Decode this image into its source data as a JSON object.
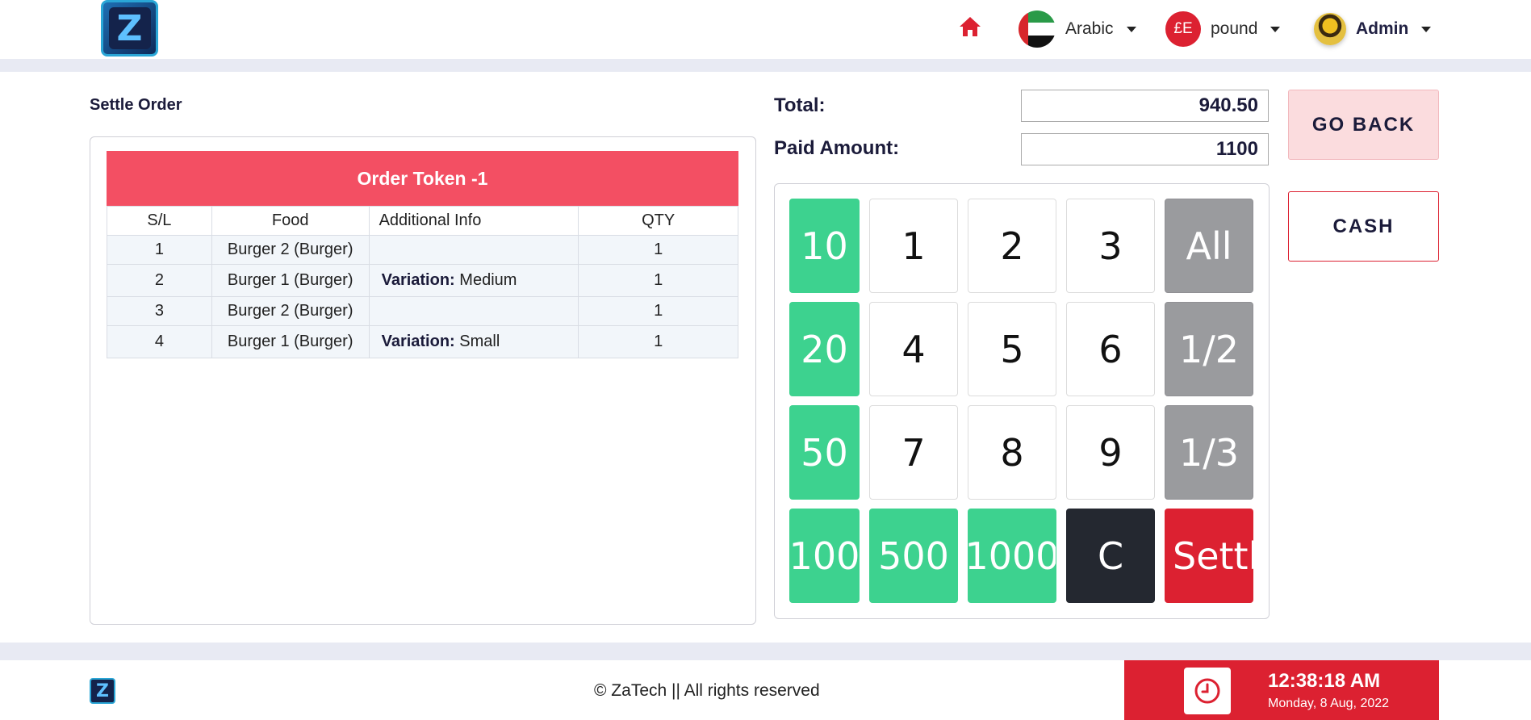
{
  "header": {
    "logo_letter": "Z",
    "language_label": "Arabic",
    "currency_symbol": "£E",
    "currency_label": "pound",
    "user_label": "Admin"
  },
  "main": {
    "title": "Settle Order",
    "order": {
      "header": "Order Token -1",
      "columns": [
        "S/L",
        "Food",
        "Additional Info",
        "QTY"
      ],
      "rows": [
        {
          "sl": "1",
          "food": "Burger 2 (Burger)",
          "info_key": "",
          "info_value": "",
          "qty": "1"
        },
        {
          "sl": "2",
          "food": "Burger 1 (Burger)",
          "info_key": "Variation:",
          "info_value": "Medium",
          "qty": "1"
        },
        {
          "sl": "3",
          "food": "Burger 2 (Burger)",
          "info_key": "",
          "info_value": "",
          "qty": "1"
        },
        {
          "sl": "4",
          "food": "Burger 1 (Burger)",
          "info_key": "Variation:",
          "info_value": "Small",
          "qty": "1"
        }
      ]
    },
    "total_label": "Total:",
    "total_value": "940.50",
    "paid_label": "Paid Amount:",
    "paid_value": "1100",
    "keypad": {
      "k10": "10",
      "k1": "1",
      "k2": "2",
      "k3": "3",
      "kall": "All",
      "k20": "20",
      "k4": "4",
      "k5": "5",
      "k6": "6",
      "khalf": "1/2",
      "k50": "50",
      "k7": "7",
      "k8": "8",
      "k9": "9",
      "kthird": "1/3",
      "k100": "100",
      "k500": "500",
      "k1000": "1000",
      "kc": "C",
      "ksettle": "Settle"
    },
    "go_back_label": "GO BACK",
    "cash_label": "CASH"
  },
  "footer": {
    "logo_letter": "Z",
    "copyright": "© ZaTech || All rights reserved",
    "time": "12:38:18 AM",
    "date": "Monday, 8 Aug, 2022"
  },
  "colors": {
    "accent_red": "#dc2131",
    "order_header": "#f34f63",
    "keypad_green": "#3dd28f",
    "keypad_gray": "#9a9b9e",
    "keypad_dark": "#242830",
    "go_back_bg": "#fbdcde"
  },
  "icons": [
    "home-icon",
    "flag-icon",
    "clock-icon",
    "chevron-down-icon"
  ]
}
